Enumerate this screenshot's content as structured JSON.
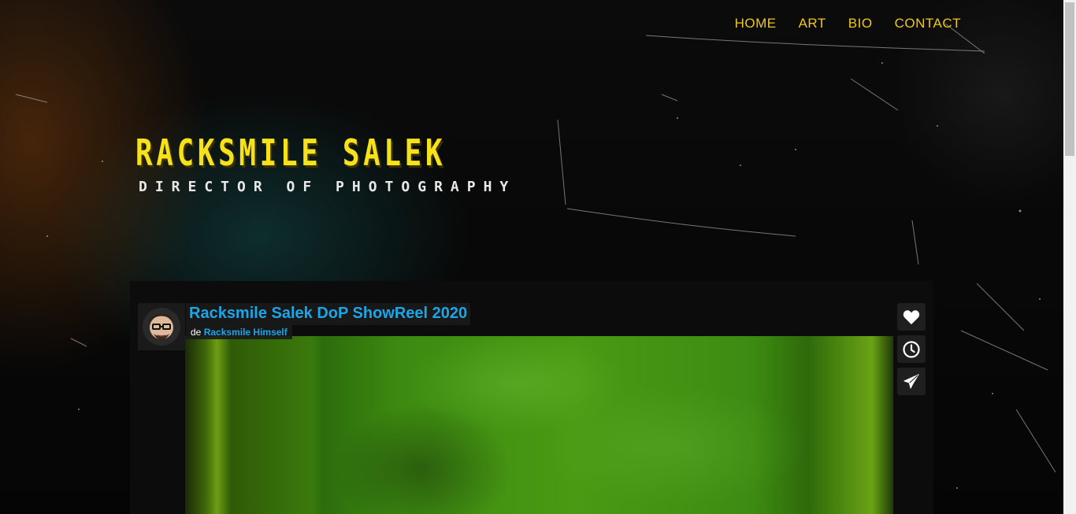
{
  "nav": {
    "items": [
      "HOME",
      "ART",
      "BIO",
      "CONTACT"
    ]
  },
  "logo": {
    "title": "RACKSMILE SALEK",
    "subtitle": "DIRECTOR OF PHOTOGRAPHY"
  },
  "player": {
    "title": "Racksmile Salek DoP ShowReel 2020",
    "by_prefix": "de",
    "author": "Racksmile Himself",
    "buttons": {
      "like": "heart-icon",
      "watch_later": "clock-icon",
      "share": "paper-plane-icon"
    }
  },
  "colors": {
    "nav": "#f0c81a",
    "logo_title": "#f5e21a",
    "link": "#1aa6e8"
  }
}
